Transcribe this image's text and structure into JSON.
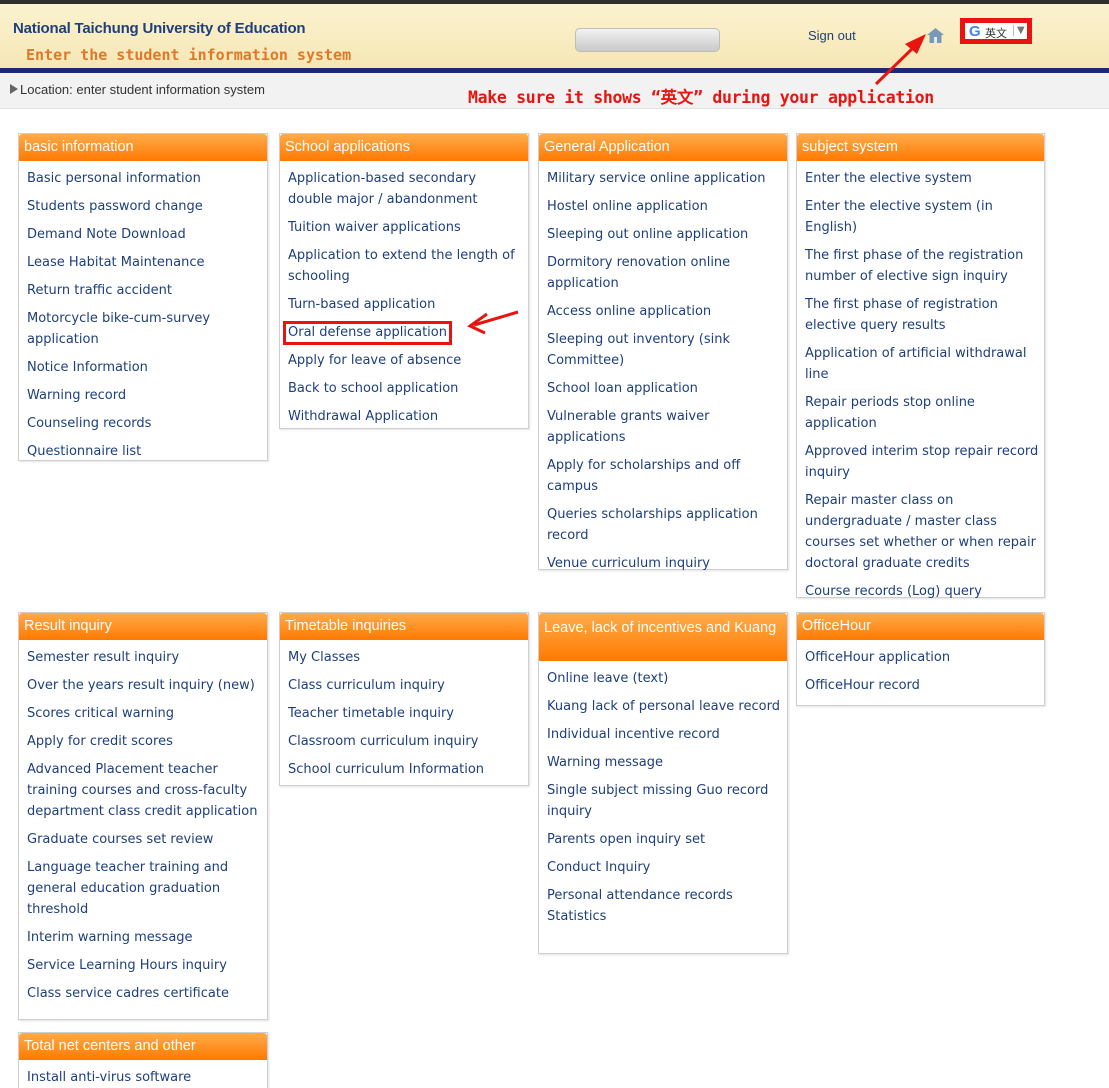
{
  "header": {
    "university": "National Taichung University of Education",
    "system_title": "Enter the student information system",
    "signout_label": "Sign out",
    "translate": {
      "logo": "G",
      "language": "英文",
      "dropdown": "▼"
    }
  },
  "location": {
    "text": "Location: enter student information system"
  },
  "annotation": {
    "note": "Make sure it shows “英文” during your application",
    "color": "#e8140f"
  },
  "colors": {
    "accent": "#ff7a00",
    "link": "#1e3f7c",
    "header_band": "#1c2a73"
  },
  "panels": {
    "basic": {
      "title": "basic information",
      "items": [
        "Basic personal information",
        "Students password change",
        "Demand Note Download",
        "Lease Habitat Maintenance",
        "Return traffic accident",
        "Motorcycle bike-cum-survey application",
        "Notice Information",
        "Warning record",
        "Counseling records",
        "Questionnaire list"
      ]
    },
    "school": {
      "title": "School applications",
      "items": [
        "Application-based secondary double major / abandonment",
        "Tuition waiver applications",
        "Application to extend the length of schooling",
        "Turn-based application",
        "Oral defense application",
        "Apply for leave of absence",
        "Back to school application",
        "Withdrawal Application"
      ]
    },
    "general": {
      "title": "General Application",
      "items": [
        "Military service online application",
        "Hostel online application",
        "Sleeping out online application",
        "Dormitory renovation online application",
        "Access online application",
        "Sleeping out inventory (sink Committee)",
        "School loan application",
        "Vulnerable grants waiver applications",
        "Apply for scholarships and off campus",
        "Queries scholarships application record",
        "Venue curriculum inquiry"
      ]
    },
    "subject": {
      "title": "subject system",
      "items": [
        "Enter the elective system",
        "Enter the elective system (in English)",
        "The first phase of the registration number of elective sign inquiry",
        "The first phase of registration elective query results",
        "Application of artificial withdrawal line",
        "Repair periods stop online application",
        "Approved interim stop repair record inquiry",
        "Repair master class on undergraduate / master class courses set whether or when repair doctoral graduate credits",
        "Course records (Log) query"
      ]
    },
    "result": {
      "title": "Result inquiry",
      "items": [
        "Semester result inquiry",
        "Over the years result inquiry (new)",
        "Scores critical warning",
        "Apply for credit scores",
        "Advanced Placement teacher training courses and cross-faculty department class credit application",
        "Graduate courses set review",
        "Language teacher training and general education graduation threshold",
        "Interim warning message",
        "Service Learning Hours inquiry",
        "Class service cadres certificate"
      ]
    },
    "timetable": {
      "title": "Timetable inquiries",
      "items": [
        "My Classes",
        "Class curriculum inquiry",
        "Teacher timetable inquiry",
        "Classroom curriculum inquiry",
        "School curriculum Information"
      ]
    },
    "leave": {
      "title": "Leave, lack of incentives and Kuang",
      "items": [
        "Online leave (text)",
        "Kuang lack of personal leave record",
        "Individual incentive record",
        "Warning message",
        "Single subject missing Guo record inquiry",
        "Parents open inquiry set",
        "Conduct Inquiry",
        "Personal attendance records Statistics"
      ]
    },
    "officehour": {
      "title": "OfficeHour",
      "items": [
        "OfficeHour application",
        "OfficeHour record"
      ]
    },
    "total": {
      "title": "Total net centers and other",
      "items": [
        "Install anti-virus software"
      ]
    }
  }
}
